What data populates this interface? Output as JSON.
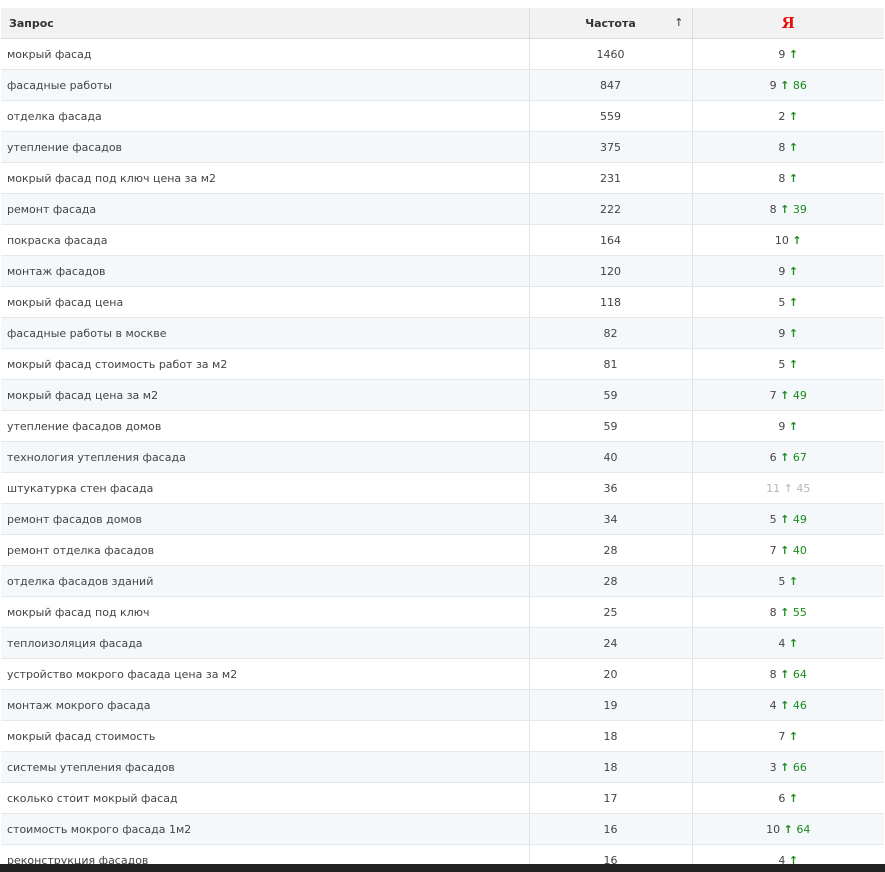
{
  "header": {
    "query": "Запрос",
    "frequency": "Частота",
    "sort_indicator": "↑",
    "yandex_logo": "Я"
  },
  "rows": [
    {
      "query": "мокрый фасад",
      "frequency": "1460",
      "position": "9",
      "arrow": "↑",
      "delta": ""
    },
    {
      "query": "фасадные работы",
      "frequency": "847",
      "position": "9",
      "arrow": "↑",
      "delta": "86"
    },
    {
      "query": "отделка фасада",
      "frequency": "559",
      "position": "2",
      "arrow": "↑",
      "delta": ""
    },
    {
      "query": "утепление фасадов",
      "frequency": "375",
      "position": "8",
      "arrow": "↑",
      "delta": ""
    },
    {
      "query": "мокрый фасад под ключ цена за м2",
      "frequency": "231",
      "position": "8",
      "arrow": "↑",
      "delta": ""
    },
    {
      "query": "ремонт фасада",
      "frequency": "222",
      "position": "8",
      "arrow": "↑",
      "delta": "39"
    },
    {
      "query": "покраска фасада",
      "frequency": "164",
      "position": "10",
      "arrow": "↑",
      "delta": ""
    },
    {
      "query": "монтаж фасадов",
      "frequency": "120",
      "position": "9",
      "arrow": "↑",
      "delta": ""
    },
    {
      "query": "мокрый фасад цена",
      "frequency": "118",
      "position": "5",
      "arrow": "↑",
      "delta": ""
    },
    {
      "query": "фасадные работы в москве",
      "frequency": "82",
      "position": "9",
      "arrow": "↑",
      "delta": ""
    },
    {
      "query": "мокрый фасад стоимость работ за м2",
      "frequency": "81",
      "position": "5",
      "arrow": "↑",
      "delta": ""
    },
    {
      "query": "мокрый фасад цена за м2",
      "frequency": "59",
      "position": "7",
      "arrow": "↑",
      "delta": "49"
    },
    {
      "query": "утепление фасадов домов",
      "frequency": "59",
      "position": "9",
      "arrow": "↑",
      "delta": ""
    },
    {
      "query": "технология утепления фасада",
      "frequency": "40",
      "position": "6",
      "arrow": "↑",
      "delta": "67"
    },
    {
      "query": "штукатурка стен фасада",
      "frequency": "36",
      "position": "11",
      "arrow": "↑",
      "delta": "45",
      "dim": true
    },
    {
      "query": "ремонт фасадов домов",
      "frequency": "34",
      "position": "5",
      "arrow": "↑",
      "delta": "49"
    },
    {
      "query": "ремонт отделка фасадов",
      "frequency": "28",
      "position": "7",
      "arrow": "↑",
      "delta": "40"
    },
    {
      "query": "отделка фасадов зданий",
      "frequency": "28",
      "position": "5",
      "arrow": "↑",
      "delta": ""
    },
    {
      "query": "мокрый фасад под ключ",
      "frequency": "25",
      "position": "8",
      "arrow": "↑",
      "delta": "55"
    },
    {
      "query": "теплоизоляция фасада",
      "frequency": "24",
      "position": "4",
      "arrow": "↑",
      "delta": ""
    },
    {
      "query": "устройство мокрого фасада цена за м2",
      "frequency": "20",
      "position": "8",
      "arrow": "↑",
      "delta": "64"
    },
    {
      "query": "монтаж мокрого фасада",
      "frequency": "19",
      "position": "4",
      "arrow": "↑",
      "delta": "46"
    },
    {
      "query": "мокрый фасад стоимость",
      "frequency": "18",
      "position": "7",
      "arrow": "↑",
      "delta": ""
    },
    {
      "query": "системы утепления фасадов",
      "frequency": "18",
      "position": "3",
      "arrow": "↑",
      "delta": "66"
    },
    {
      "query": "сколько стоит мокрый фасад",
      "frequency": "17",
      "position": "6",
      "arrow": "↑",
      "delta": ""
    },
    {
      "query": "стоимость мокрого фасада 1м2",
      "frequency": "16",
      "position": "10",
      "arrow": "↑",
      "delta": "64"
    },
    {
      "query": "реконструкция фасадов",
      "frequency": "16",
      "position": "4",
      "arrow": "↑",
      "delta": ""
    }
  ],
  "colors": {
    "arrow_up": "#1a8b1a",
    "dim": "#b5b5b5",
    "yandex": "#e5100c",
    "row_alt": "#f4f8fb"
  }
}
